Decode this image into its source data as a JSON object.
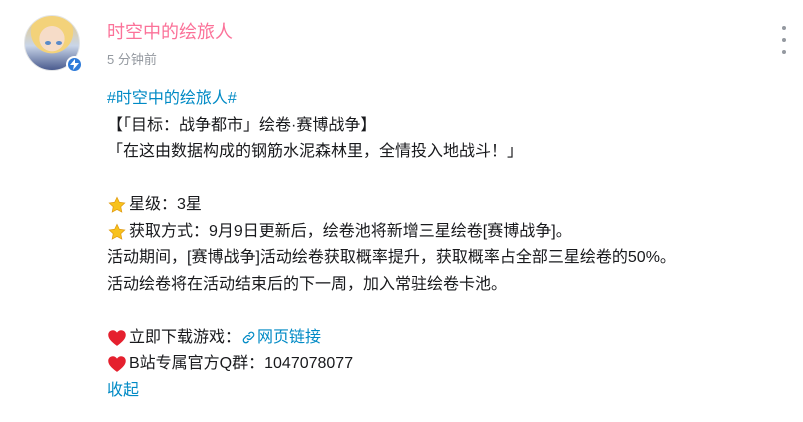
{
  "author": {
    "name": "时空中的绘旅人",
    "time": "5 分钟前"
  },
  "post": {
    "topic": "#时空中的绘旅人#",
    "title": "【「目标：战争都市」绘卷·赛博战争】",
    "quote": "「在这由数据构成的钢筋水泥森林里，全情投入地战斗！」",
    "star_label": "星级：3星",
    "acquire_label": "获取方式：9月9日更新后，绘卷池将新增三星绘卷[赛博战争]。",
    "event_line": "活动期间，[赛博战争]活动绘卷获取概率提升，获取概率占全部三星绘卷的50%。",
    "after_line": "活动绘卷将在活动结束后的下一周，加入常驻绘卷卡池。",
    "download_label": "立即下载游戏：",
    "download_link": "网页链接",
    "qq_label": "B站专属官方Q群：1047078077",
    "collapse": "收起"
  },
  "icons": {
    "star": "star-emoji-icon",
    "heart": "heart-emoji-icon",
    "link": "link-icon",
    "more": "more-vertical-icon",
    "verified": "verified-lightning-icon"
  },
  "colors": {
    "name": "#fb7299",
    "link": "#008ac5",
    "muted": "#9499a0",
    "text": "#18191c"
  }
}
